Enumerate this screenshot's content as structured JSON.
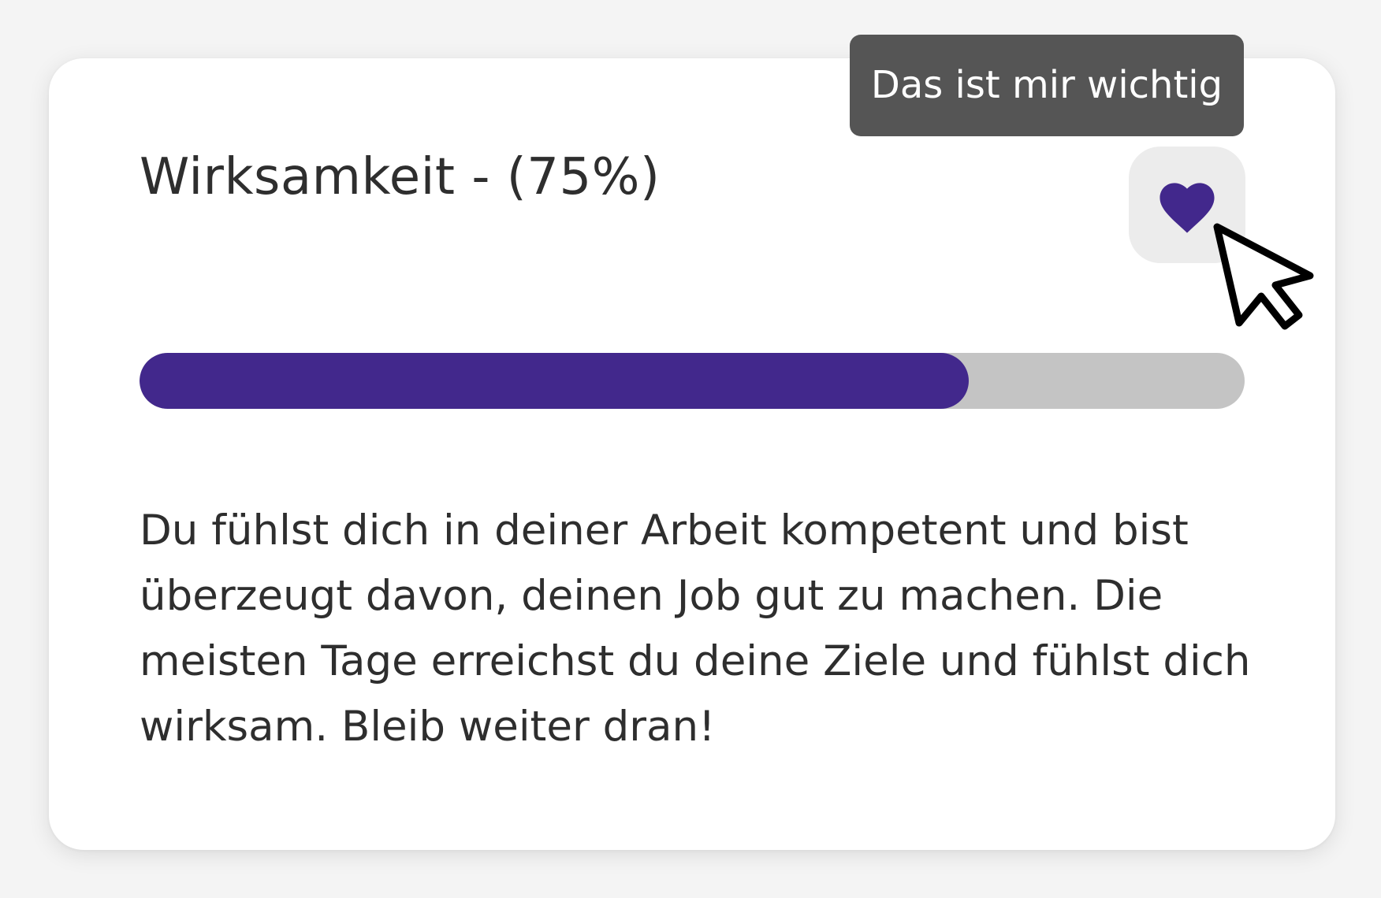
{
  "card": {
    "title": "Wirksamkeit - (75%)",
    "progress": 0.75,
    "description": "Du fühlst dich in deiner Arbeit kompetent und bist überzeugt davon, deinen Job gut zu machen. Die meisten Tage erreichst du deine Ziele und fühlst dich wirksam. Bleib weiter dran!"
  },
  "tooltip": {
    "text": "Das ist mir wichtig"
  },
  "favorite_button": {
    "icon": "heart-icon",
    "state": "active"
  },
  "colors": {
    "accent": "#42288c",
    "track": "#c4c4c4",
    "tooltip_bg": "#555555",
    "button_bg": "#ececec"
  }
}
